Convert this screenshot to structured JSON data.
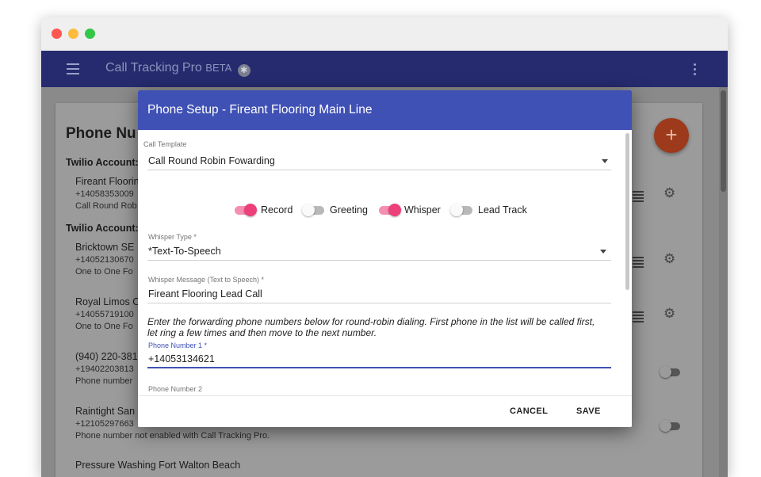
{
  "app": {
    "title": "Call Tracking Pro",
    "beta": "BETA",
    "beta_icon": "spider-icon"
  },
  "page": {
    "title": "Phone Nu"
  },
  "accounts": [
    {
      "label": "Twilio Account:"
    },
    {
      "label": "Twilio Account:"
    }
  ],
  "phones": [
    {
      "name": "Fireant Floorin",
      "number": "+14058353009",
      "desc": "Call Round Rob"
    },
    {
      "name": "Bricktown SE",
      "number": "+14052130670",
      "desc": "One to One Fo"
    },
    {
      "name": "Royal Limos C",
      "number": "+14055719100",
      "desc": "One to One Fo"
    },
    {
      "name": "(940) 220-381",
      "number": "+19402203813",
      "desc": "Phone number"
    },
    {
      "name": "Raintight San",
      "number": "+12105297663",
      "desc": "Phone number not enabled with Call Tracking Pro."
    },
    {
      "name": "Pressure Washing Fort Walton Beach",
      "number": "",
      "desc": ""
    }
  ],
  "fab_label": "+",
  "dialog": {
    "title": "Phone Setup - Fireant Flooring Main Line",
    "call_template": {
      "label": "Call Template",
      "value": "Call Round Robin Fowarding"
    },
    "toggles": [
      {
        "label": "Record",
        "on": true
      },
      {
        "label": "Greeting",
        "on": false
      },
      {
        "label": "Whisper",
        "on": true
      },
      {
        "label": "Lead Track",
        "on": false
      }
    ],
    "whisper_type": {
      "label": "Whisper Type *",
      "value": "*Text-To-Speech"
    },
    "whisper_message": {
      "label": "Whisper Message (Text to Speech) *",
      "value": "Fireant Flooring Lead Call"
    },
    "instructions": "Enter the forwarding phone numbers below for round-robin dialing. First phone in the list will be called first, let ring a few times and then move to the next number.",
    "phone1": {
      "label": "Phone Number 1 *",
      "value": "+14053134621"
    },
    "phone2": {
      "label": "Phone Number 2",
      "value": ""
    },
    "cancel_label": "CANCEL",
    "save_label": "SAVE"
  },
  "colors": {
    "appbar": "#252b6e",
    "dialog_header": "#3f51b5",
    "toggle_on": "#ec407a",
    "fab": "#9c3a1b"
  }
}
